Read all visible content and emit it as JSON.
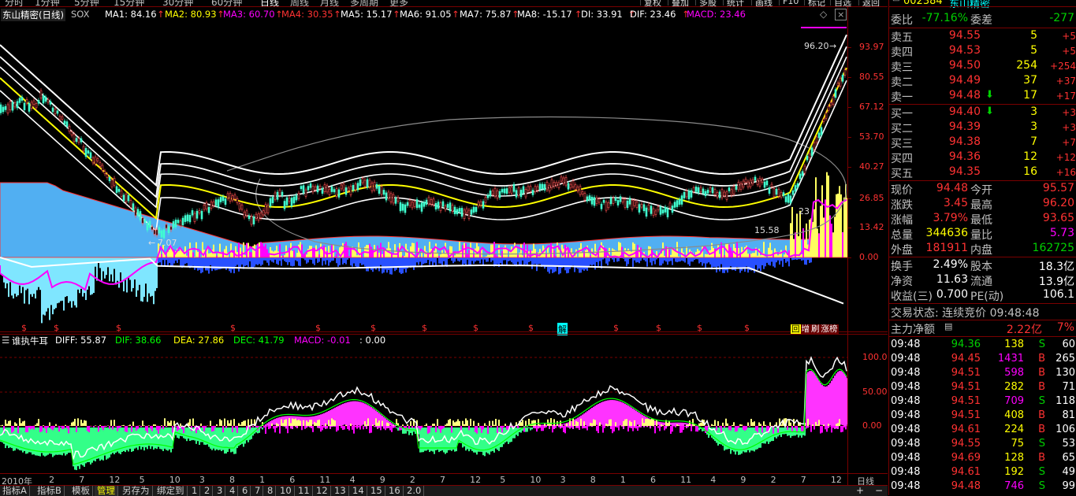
{
  "toolbar": {
    "periods": [
      "分时",
      "1分钟",
      "5分钟",
      "15分钟",
      "30分钟",
      "60分钟",
      "日线",
      "周线",
      "月线",
      "多周期",
      "更多"
    ],
    "active_period": "日线",
    "buttons": [
      "复权",
      "叠加",
      "多股",
      "统计",
      "画线",
      "F10",
      "标记",
      "自选",
      "返回"
    ]
  },
  "main_header": {
    "stock": "东山精密(日线)",
    "sox": "SOX",
    "ma": [
      {
        "label": "MA1: 84.16",
        "color": "#ffffff"
      },
      {
        "label": "MA2: 80.93",
        "color": "#ffff00"
      },
      {
        "label": "MA3: 60.70",
        "color": "#ff00ff"
      },
      {
        "label": "MA4: 30.35",
        "color": "#ff3232"
      },
      {
        "label": "MA5: 15.17",
        "color": "#ffffff"
      },
      {
        "label": "MA6: 91.05",
        "color": "#ffffff"
      },
      {
        "label": "MA7: 75.87",
        "color": "#ffffff"
      },
      {
        "label": "MA8: -15.17",
        "color": "#ffffff"
      },
      {
        "label": "DI: 33.91",
        "color": "#ffffff"
      },
      {
        "label": "DIF: 23.46",
        "color": "#ffffff"
      },
      {
        "label": "MACD: 23.46",
        "color": "#ff00ff"
      }
    ],
    "arrows": [
      "↑",
      "↑",
      "↑",
      "↑",
      "↑",
      "↑",
      "↑",
      "↑",
      "↑",
      "↑"
    ]
  },
  "price_axis": [
    "93.97",
    "80.55",
    "67.12",
    "53.70",
    "40.27",
    "26.85",
    "13.42",
    "0.00"
  ],
  "annotations": {
    "high": "96.20",
    "low": "7.07",
    "mid1": "15.58",
    "mid2": "23"
  },
  "event_marks": {
    "s": "$",
    "jie": "解"
  },
  "corner_badges": [
    "回",
    "增",
    "刷",
    "涨榜"
  ],
  "sub_header": {
    "name": "谁执牛耳",
    "diff": "DIFF: 55.87",
    "dif": "DIF: 38.66",
    "dea": "DEA: 27.86",
    "dec": "DEC: 41.79",
    "macd": "MACD: -0.01",
    "extra": ": 0.00"
  },
  "sub_axis": [
    "100.0",
    "50.00",
    "0.00"
  ],
  "x_axis": [
    "2010年",
    "2",
    "7",
    "12",
    "5",
    "10",
    "3",
    "8",
    "1",
    "6",
    "11",
    "4",
    "9",
    "2",
    "7",
    "12",
    "5",
    "10",
    "3",
    "8",
    "1",
    "6",
    "11",
    "4",
    "9",
    "2",
    "7",
    "12"
  ],
  "x_axis_end": "日线",
  "bottom_tabs": [
    "指标A",
    "指标B",
    "模板",
    "管理",
    "另存为",
    "绑定到",
    "1",
    "2",
    "3",
    "4",
    "6",
    "7",
    "8",
    "10",
    "11",
    "12",
    "13",
    "14",
    "15",
    "16",
    "2.0"
  ],
  "active_tab": "管理",
  "quote": {
    "code": "002384",
    "name": "东山精密",
    "weibi_label": "委比",
    "weibi": "-77.16%",
    "weicha_label": "委差",
    "weicha": "-277",
    "asks": [
      {
        "label": "卖五",
        "price": "94.55",
        "vol": "5",
        "chg": "+5"
      },
      {
        "label": "卖四",
        "price": "94.53",
        "vol": "5",
        "chg": "+5"
      },
      {
        "label": "卖三",
        "price": "94.50",
        "vol": "254",
        "chg": "+254"
      },
      {
        "label": "卖二",
        "price": "94.49",
        "vol": "37",
        "chg": "+37"
      },
      {
        "label": "卖一",
        "price": "94.48",
        "vol": "17",
        "chg": "+17"
      }
    ],
    "bids": [
      {
        "label": "买一",
        "price": "94.40",
        "vol": "3",
        "chg": "+3"
      },
      {
        "label": "买二",
        "price": "94.39",
        "vol": "3",
        "chg": "+3"
      },
      {
        "label": "买三",
        "price": "94.38",
        "vol": "7",
        "chg": "+7"
      },
      {
        "label": "买四",
        "price": "94.36",
        "vol": "12",
        "chg": "+12"
      },
      {
        "label": "买五",
        "price": "94.35",
        "vol": "16",
        "chg": "+16"
      }
    ],
    "stats": [
      {
        "l1": "现价",
        "v1": "94.48",
        "c1": "#ff3232",
        "l2": "今开",
        "v2": "95.57",
        "c2": "#ff3232"
      },
      {
        "l1": "涨跌",
        "v1": "3.45",
        "c1": "#ff3232",
        "l2": "最高",
        "v2": "96.20",
        "c2": "#ff3232"
      },
      {
        "l1": "涨幅",
        "v1": "3.79%",
        "c1": "#ff3232",
        "l2": "最低",
        "v2": "93.65",
        "c2": "#ff3232"
      },
      {
        "l1": "总量",
        "v1": "344636",
        "c1": "#ffff00",
        "l2": "量比",
        "v2": "5.73",
        "c2": "#ff00ff"
      },
      {
        "l1": "外盘",
        "v1": "181911",
        "c1": "#ff3232",
        "l2": "内盘",
        "v2": "162725",
        "c2": "#00d000"
      }
    ],
    "stats2": [
      {
        "l1": "换手",
        "v1": "2.49%",
        "l2": "股本",
        "v2": "18.3亿"
      },
      {
        "l1": "净资",
        "v1": "11.63",
        "l2": "流通",
        "v2": "13.9亿"
      },
      {
        "l1": "收益(三)",
        "v1": "0.700",
        "l2": "PE(动)",
        "v2": "106.1"
      }
    ],
    "trade_state": "交易状态: 连续竞价 09:48:48",
    "net_label": "主力净额",
    "net_value": "2.22亿",
    "net_pct": "7%",
    "ticks": [
      {
        "t": "09:48",
        "p": "94.36",
        "v": "138",
        "s": "S",
        "n": "60",
        "pc": "#00d000",
        "vc": "#ffff00"
      },
      {
        "t": "09:48",
        "p": "94.45",
        "v": "1431",
        "s": "B",
        "n": "265",
        "pc": "#ff3232",
        "vc": "#ff00ff"
      },
      {
        "t": "09:48",
        "p": "94.51",
        "v": "598",
        "s": "B",
        "n": "130",
        "pc": "#ff3232",
        "vc": "#ff00ff"
      },
      {
        "t": "09:48",
        "p": "94.51",
        "v": "282",
        "s": "B",
        "n": "71",
        "pc": "#ff3232",
        "vc": "#ffff00"
      },
      {
        "t": "09:48",
        "p": "94.51",
        "v": "709",
        "s": "S",
        "n": "118",
        "pc": "#ff3232",
        "vc": "#ff00ff"
      },
      {
        "t": "09:48",
        "p": "94.51",
        "v": "408",
        "s": "B",
        "n": "81",
        "pc": "#ff3232",
        "vc": "#ffff00"
      },
      {
        "t": "09:48",
        "p": "94.61",
        "v": "224",
        "s": "B",
        "n": "106",
        "pc": "#ff3232",
        "vc": "#ffff00"
      },
      {
        "t": "09:48",
        "p": "94.55",
        "v": "75",
        "s": "S",
        "n": "53",
        "pc": "#ff3232",
        "vc": "#ffff00"
      },
      {
        "t": "09:48",
        "p": "94.69",
        "v": "128",
        "s": "B",
        "n": "65",
        "pc": "#ff3232",
        "vc": "#ffff00"
      },
      {
        "t": "09:48",
        "p": "94.61",
        "v": "192",
        "s": "S",
        "n": "49",
        "pc": "#ff3232",
        "vc": "#ffff00"
      },
      {
        "t": "09:48",
        "p": "94.48",
        "v": "746",
        "s": "S",
        "n": "99",
        "pc": "#ff3232",
        "vc": "#ff00ff"
      }
    ]
  },
  "colors": {
    "frame": "#7a0000",
    "accent_cyan": "#00ffff",
    "up": "#ff3232",
    "down": "#00d000"
  }
}
